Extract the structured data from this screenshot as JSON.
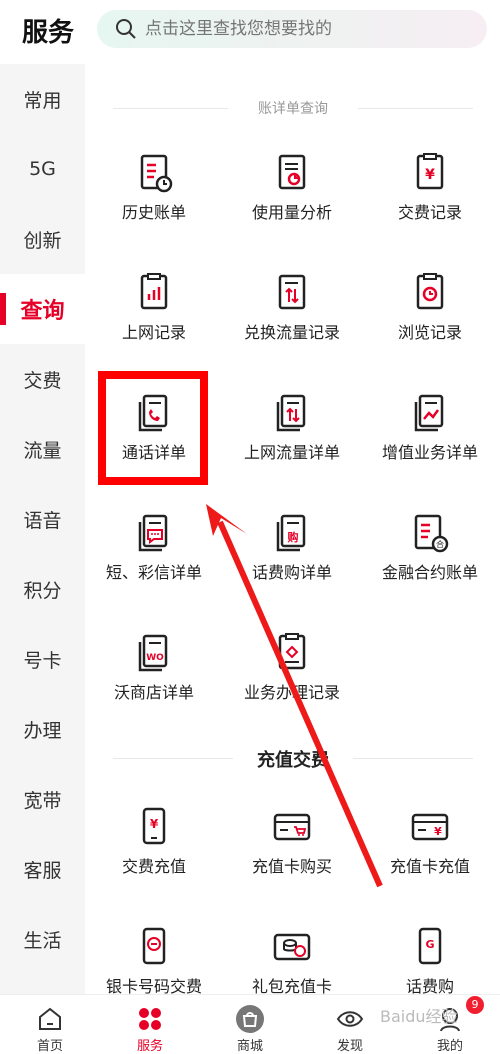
{
  "header": {
    "title": "服务",
    "search_placeholder": "点击这里查找您想要找的"
  },
  "sidebar": {
    "items": [
      "常用",
      "5G",
      "创新",
      "查询",
      "交费",
      "流量",
      "语音",
      "积分",
      "号卡",
      "办理",
      "宽带",
      "客服",
      "生活"
    ],
    "active": "查询"
  },
  "section1": {
    "title": "账详单查询",
    "items": [
      {
        "label": "历史账单",
        "icon": "history-bill-icon"
      },
      {
        "label": "使用量分析",
        "icon": "usage-analysis-icon"
      },
      {
        "label": "交费记录",
        "icon": "payment-record-icon"
      },
      {
        "label": "上网记录",
        "icon": "internet-record-icon"
      },
      {
        "label": "兑换流量记录",
        "icon": "exchange-data-icon"
      },
      {
        "label": "浏览记录",
        "icon": "browse-record-icon"
      },
      {
        "label": "通话详单",
        "icon": "call-detail-icon"
      },
      {
        "label": "上网流量详单",
        "icon": "data-detail-icon"
      },
      {
        "label": "增值业务详单",
        "icon": "value-added-icon"
      },
      {
        "label": "短、彩信详单",
        "icon": "sms-detail-icon"
      },
      {
        "label": "话费购详单",
        "icon": "purchase-detail-icon"
      },
      {
        "label": "金融合约账单",
        "icon": "finance-contract-icon"
      },
      {
        "label": "沃商店详单",
        "icon": "wo-store-icon"
      },
      {
        "label": "业务办理记录",
        "icon": "service-record-icon"
      }
    ]
  },
  "section2": {
    "title": "充值交费",
    "items": [
      {
        "label": "交费充值",
        "icon": "phone-yuan-icon"
      },
      {
        "label": "充值卡购买",
        "icon": "card-cart-icon"
      },
      {
        "label": "充值卡充值",
        "icon": "card-yuan-icon"
      },
      {
        "label": "银卡号码交费",
        "icon": "phone-minus-icon"
      },
      {
        "label": "礼包充值卡",
        "icon": "card-coin-icon"
      },
      {
        "label": "话费购",
        "icon": "phone-g-icon"
      }
    ]
  },
  "bottom_nav": {
    "items": [
      "首页",
      "服务",
      "商城",
      "发现",
      "我的"
    ],
    "active": "服务",
    "badge": "9"
  },
  "watermark": "Baidu经验",
  "colors": {
    "accent": "#e60027",
    "highlight": "#ff0000"
  }
}
